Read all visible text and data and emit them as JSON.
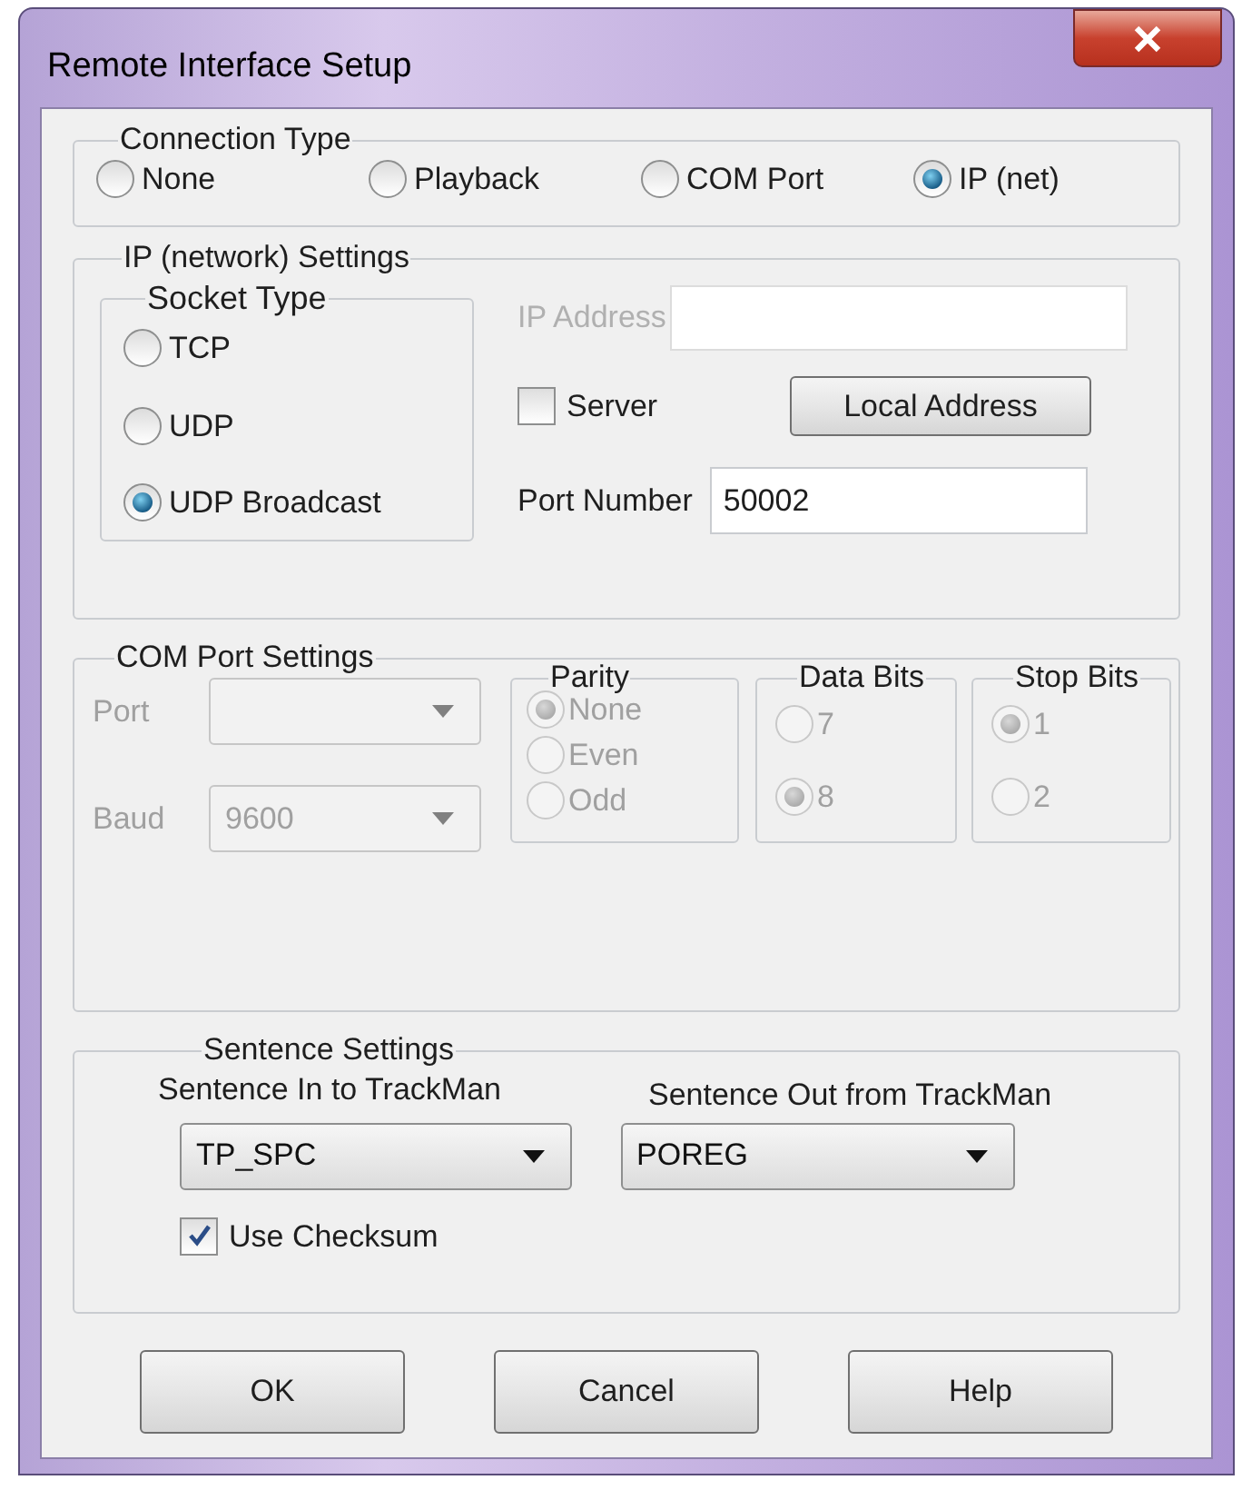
{
  "window": {
    "title": "Remote Interface Setup"
  },
  "connection_type": {
    "title": "Connection Type",
    "options": [
      {
        "label": "None",
        "selected": false
      },
      {
        "label": "Playback",
        "selected": false
      },
      {
        "label": "COM Port",
        "selected": false
      },
      {
        "label": "IP (net)",
        "selected": true
      }
    ]
  },
  "ip_settings": {
    "title": "IP (network) Settings",
    "socket_type": {
      "title": "Socket Type",
      "options": [
        {
          "label": "TCP",
          "selected": false
        },
        {
          "label": "UDP",
          "selected": false
        },
        {
          "label": "UDP Broadcast",
          "selected": true
        }
      ]
    },
    "ip_address": {
      "label": "IP Address",
      "disabled": true
    },
    "server": {
      "label": "Server",
      "checked": false
    },
    "local_address_button": "Local Address",
    "port_number": {
      "label": "Port Number",
      "value": "50002"
    }
  },
  "com_port_settings": {
    "title": "COM Port Settings",
    "disabled": true,
    "port": {
      "label": "Port"
    },
    "baud": {
      "label": "Baud",
      "value": "9600"
    },
    "parity": {
      "title": "Parity",
      "options": [
        {
          "label": "None",
          "selected": true
        },
        {
          "label": "Even",
          "selected": false
        },
        {
          "label": "Odd",
          "selected": false
        }
      ]
    },
    "data_bits": {
      "title": "Data Bits",
      "options": [
        {
          "label": "7",
          "selected": false
        },
        {
          "label": "8",
          "selected": true
        }
      ]
    },
    "stop_bits": {
      "title": "Stop Bits",
      "options": [
        {
          "label": "1",
          "selected": true
        },
        {
          "label": "2",
          "selected": false
        }
      ]
    }
  },
  "sentence_settings": {
    "title": "Sentence Settings",
    "sentence_in": {
      "label": "Sentence In to TrackMan",
      "value": "TP_SPC"
    },
    "sentence_out": {
      "label": "Sentence Out from TrackMan",
      "value": "POREG"
    },
    "use_checksum": {
      "label": "Use Checksum",
      "checked": true
    }
  },
  "buttons": [
    "OK",
    "Cancel",
    "Help"
  ]
}
